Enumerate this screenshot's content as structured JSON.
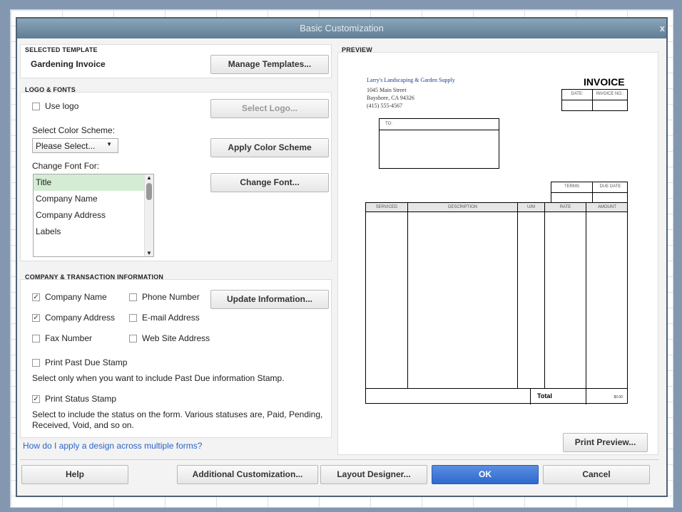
{
  "dialog": {
    "title": "Basic Customization",
    "close": "x"
  },
  "selected_template": {
    "heading": "SELECTED TEMPLATE",
    "name": "Gardening Invoice",
    "manage_button": "Manage Templates..."
  },
  "logo_fonts": {
    "heading": "LOGO & FONTS",
    "use_logo": {
      "label": "Use logo",
      "checked": false
    },
    "select_logo_button": "Select Logo...",
    "color_scheme_label": "Select Color Scheme:",
    "color_scheme_value": "Please Select...",
    "apply_color_button": "Apply Color Scheme",
    "change_font_label": "Change Font For:",
    "font_items": [
      "Title",
      "Company Name",
      "Company Address",
      "Labels"
    ],
    "selected_font_item": "Title",
    "change_font_button": "Change Font..."
  },
  "company_info": {
    "heading": "COMPANY & TRANSACTION INFORMATION",
    "checkboxes": [
      {
        "label": "Company Name",
        "checked": true
      },
      {
        "label": "Company Address",
        "checked": true
      },
      {
        "label": "Fax Number",
        "checked": false
      },
      {
        "label": "Phone Number",
        "checked": false
      },
      {
        "label": "E-mail Address",
        "checked": false
      },
      {
        "label": "Web Site Address",
        "checked": false
      }
    ],
    "update_button": "Update Information...",
    "past_due": {
      "label": "Print Past Due Stamp",
      "checked": false,
      "note": "Select only when you want to include Past Due information Stamp."
    },
    "status": {
      "label": "Print Status Stamp",
      "checked": true,
      "note": "Select to include the status on the form. Various statuses are, Paid, Pending, Received, Void, and so on."
    }
  },
  "help_link": "How do I apply a design across multiple forms?",
  "preview": {
    "heading": "PREVIEW",
    "company_name": "Larry's Landscaping & Garden Supply",
    "address1": "1045 Main Street",
    "address2": "Bayshore, CA 94326",
    "phone": "(415) 555-4567",
    "doc_title": "INVOICE",
    "date_label": "DATE:",
    "invoice_no_label": "INVOICE NO.:",
    "to_label": "TO:",
    "terms_label": "TERMS",
    "due_date_label": "DUE DATE",
    "columns": [
      "SERVICED",
      "DESCRIPTION",
      "U/M",
      "RATE",
      "AMOUNT"
    ],
    "total_label": "Total",
    "total_value": "$0.00",
    "print_preview_button": "Print Preview..."
  },
  "footer": {
    "help": "Help",
    "additional": "Additional Customization...",
    "layout": "Layout Designer...",
    "ok": "OK",
    "cancel": "Cancel"
  }
}
